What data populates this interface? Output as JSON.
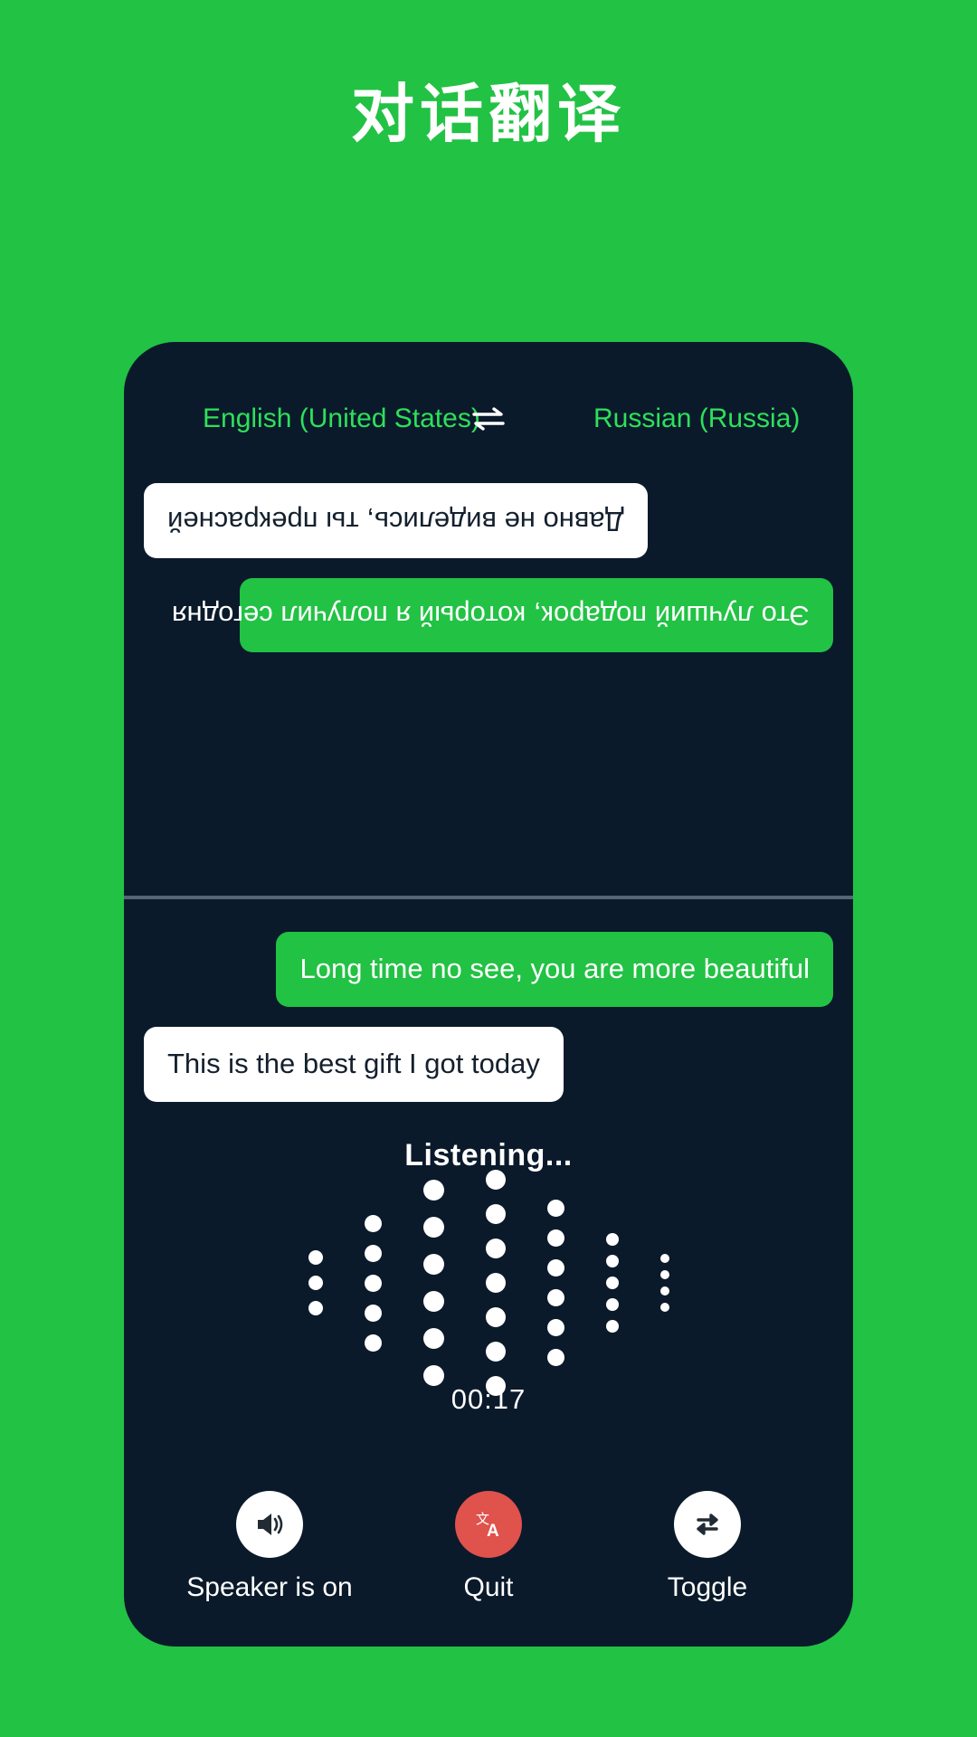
{
  "page": {
    "title": "对话翻译",
    "background_color": "#22c244"
  },
  "card": {
    "background_color": "#0a1a2b"
  },
  "language_bar": {
    "source_language": "English (United States)",
    "target_language": "Russian (Russia)",
    "swap_icon": "swap-horizontal-icon",
    "text_color": "#2ee05a"
  },
  "conversation": {
    "remote_panel": {
      "rotated": true,
      "messages": [
        {
          "text": "Это лучший подарок, который я получил сегодня",
          "style": "green",
          "align": "left"
        },
        {
          "text": "Давно не виделись, ты прекрасней",
          "style": "white",
          "align": "right"
        }
      ]
    },
    "local_panel": {
      "rotated": false,
      "messages": [
        {
          "text": "Long time no see, you are more beautiful",
          "style": "green",
          "align": "right"
        },
        {
          "text": "This is the best gift I got today",
          "style": "white",
          "align": "left"
        }
      ]
    }
  },
  "status": {
    "listening_label": "Listening...",
    "timer": "00:17"
  },
  "waveform": {
    "columns": [
      {
        "count": 3,
        "size": 16
      },
      {
        "count": 5,
        "size": 19
      },
      {
        "count": 6,
        "size": 23
      },
      {
        "count": 7,
        "size": 22
      },
      {
        "count": 6,
        "size": 19
      },
      {
        "count": 5,
        "size": 14
      },
      {
        "count": 4,
        "size": 10
      }
    ],
    "dot_color": "#ffffff"
  },
  "actions": [
    {
      "label": "Speaker is on",
      "icon": "speaker-on-icon",
      "circle_color": "#ffffff",
      "icon_color": "#222b33"
    },
    {
      "label": "Quit",
      "icon": "translate-icon",
      "circle_color": "#e0524c",
      "icon_color": "#ffffff"
    },
    {
      "label": "Toggle",
      "icon": "swap-repeat-icon",
      "circle_color": "#ffffff",
      "icon_color": "#222b33"
    }
  ]
}
